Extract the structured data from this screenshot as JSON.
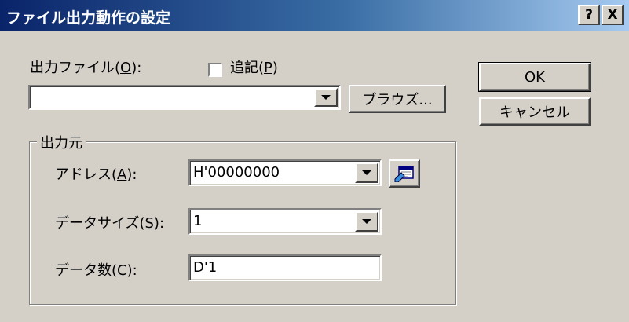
{
  "window": {
    "title": "ファイル出力動作の設定",
    "help_label": "?",
    "close_label": "X"
  },
  "output_file": {
    "label": "出力ファイル(",
    "mnemonic": "O",
    "label_end": "):",
    "value": ""
  },
  "append": {
    "label": "追記(",
    "mnemonic": "P",
    "label_end": ")",
    "checked": false
  },
  "browse_button": "ブラウズ...",
  "ok_button": "OK",
  "cancel_button": "キャンセル",
  "source_group": {
    "legend": "出力元",
    "address": {
      "label": "アドレス(",
      "mnemonic": "A",
      "label_end": "):",
      "value": "H'00000000"
    },
    "data_size": {
      "label": "データサイズ(",
      "mnemonic": "S",
      "label_end": "):",
      "value": "1"
    },
    "data_count": {
      "label": "データ数(",
      "mnemonic": "C",
      "label_end": "):",
      "value": "D'1"
    }
  },
  "icons": {
    "address_picker": "address-picker-icon"
  }
}
